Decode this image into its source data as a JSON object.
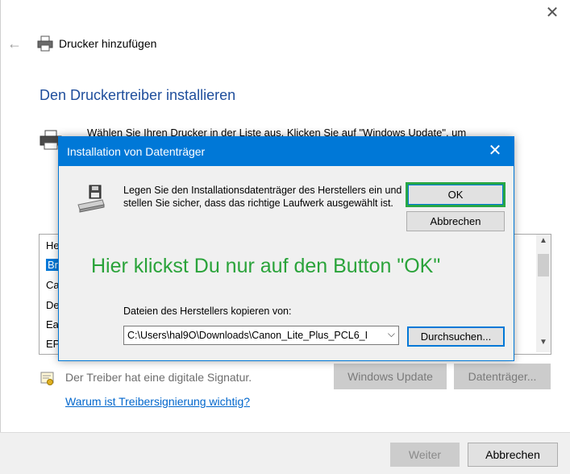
{
  "window": {
    "title": "Drucker hinzufügen",
    "close_icon": "close-icon",
    "back_icon": "back-arrow-icon",
    "title_icon": "printer-icon"
  },
  "page": {
    "heading": "Den Druckertreiber installieren",
    "intro_text": "Wählen Sie Ihren Drucker in der Liste aus. Klicken Sie auf \"Windows Update\", um"
  },
  "manufacturer_list": {
    "items": [
      {
        "label": "He",
        "selected": false
      },
      {
        "label": "Br",
        "selected": true
      },
      {
        "label": "Ca",
        "selected": false
      },
      {
        "label": "De",
        "selected": false
      },
      {
        "label": "Ea",
        "selected": false
      },
      {
        "label": "EP",
        "selected": false
      }
    ]
  },
  "signature": {
    "text": "Der Treiber hat eine digitale Signatur.",
    "link": "Warum ist Treibersignierung wichtig?"
  },
  "buttons": {
    "windows_update": "Windows Update",
    "datentraeger": "Datenträger...",
    "weiter": "Weiter",
    "abbrechen": "Abbrechen"
  },
  "dialog": {
    "title": "Installation von Datenträger",
    "message": "Legen Sie den Installationsdatenträger des Herstellers ein und stellen Sie sicher, dass das richtige Laufwerk ausgewählt ist.",
    "ok_label": "OK",
    "cancel_label": "Abbrechen",
    "annotation": "Hier klickst Du nur auf den Button \"OK\"",
    "copy_label": "Dateien des Herstellers kopieren von:",
    "path_value": "C:\\Users\\hal9O\\Downloads\\Canon_Lite_Plus_PCL6_I",
    "browse_label": "Durchsuchen...",
    "annotation_color": "#2aa33a",
    "accent_color": "#0078d7"
  }
}
